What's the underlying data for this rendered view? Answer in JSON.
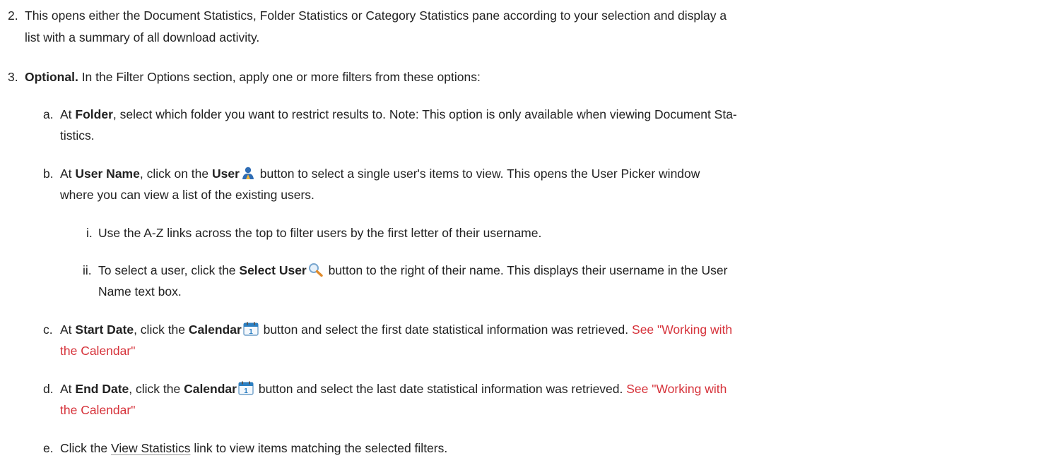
{
  "steps": [
    {
      "number": "2.",
      "line1": "This opens either the Document Statistics, Folder Statistics or Category Statistics pane according to your selection and display a",
      "line2": "list with a summary of all download activity."
    },
    {
      "number": "3.",
      "bold": "Optional.",
      "text": " In the Filter Options section, apply one or more filters from these options:"
    }
  ],
  "substeps": {
    "a": {
      "letter": "a.",
      "pre": "At ",
      "bold": "Folder",
      "line1": ", select which folder you want to restrict results to. Note: This option is only available when viewing Document Sta-",
      "line2": "tistics."
    },
    "b": {
      "letter": "b.",
      "pre": "At ",
      "bold1": "User Name",
      "mid": ", click on the ",
      "bold2": "User",
      "post": " button to select a single user's items to view. This opens the User Picker window",
      "line2": "where you can view a list of the existing users.",
      "icon": "user-icon"
    },
    "bi": {
      "letter": "i.",
      "text": "Use the A-Z links across the top to filter users by the first letter of their username."
    },
    "bii": {
      "letter": "ii.",
      "pre": "To select a user, click the ",
      "bold": "Select User",
      "post": " button to the right of their name. This displays their username in the User",
      "line2": "Name text box.",
      "icon": "magnifier-icon"
    },
    "c": {
      "letter": "c.",
      "pre": "At ",
      "bold1": "Start Date",
      "mid": ", click the ",
      "bold2": "Calendar",
      "post": " button and select the first date statistical information was retrieved. ",
      "link1": "See \"Working with",
      "link2": "the Calendar\"",
      "icon": "calendar-icon"
    },
    "d": {
      "letter": "d.",
      "pre": "At ",
      "bold1": "End Date",
      "mid": ", click the ",
      "bold2": "Calendar",
      "post": " button and select the last date statistical information was retrieved. ",
      "link1": "See \"Working with",
      "link2": "the Calendar\"",
      "icon": "calendar-icon"
    },
    "e": {
      "letter": "e.",
      "pre": "Click the ",
      "link": "View Statistics",
      "post": " link to view items matching the selected filters."
    }
  },
  "colors": {
    "text": "#222222",
    "link": "#d6323a",
    "user_icon": "#2f6db5",
    "calendar_icon": "#2b7fc2"
  }
}
